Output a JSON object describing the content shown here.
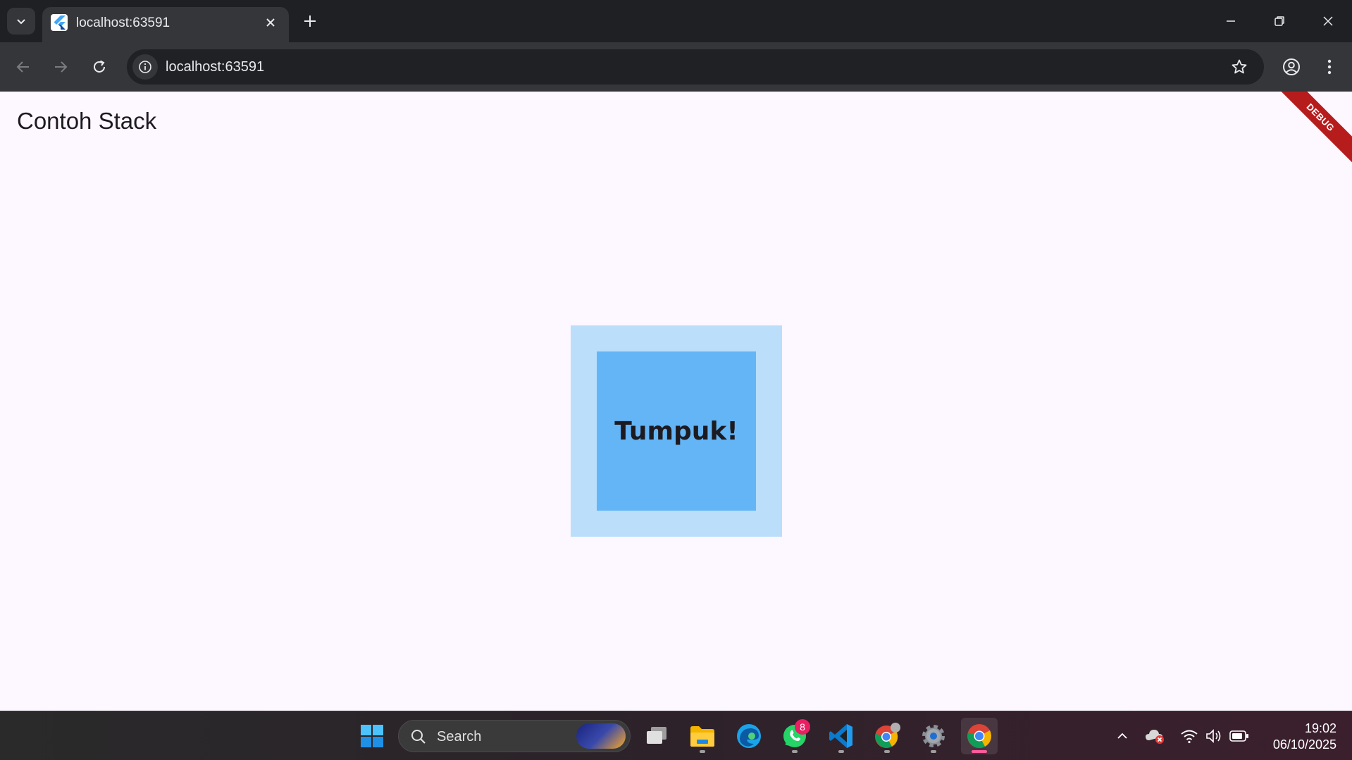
{
  "browser": {
    "tab_title": "localhost:63591",
    "url": "localhost:63591"
  },
  "page": {
    "title": "Contoh Stack",
    "debug_banner": "DEBUG",
    "stack_label": "Tumpuk!",
    "colors": {
      "background": "#fdf7ff",
      "outer_box": "#bbdefb",
      "inner_box": "#64b5f6",
      "debug_banner": "#b71c1c"
    }
  },
  "taskbar": {
    "search_label": "Search",
    "whatsapp_badge": "8",
    "time": "19:02",
    "date": "06/10/2025",
    "apps": [
      "start-icon",
      "search-icon",
      "task-view-icon",
      "file-explorer-icon",
      "edge-icon",
      "whatsapp-icon",
      "vscode-icon",
      "chrome-profile-icon",
      "settings-icon",
      "chrome-icon"
    ]
  }
}
